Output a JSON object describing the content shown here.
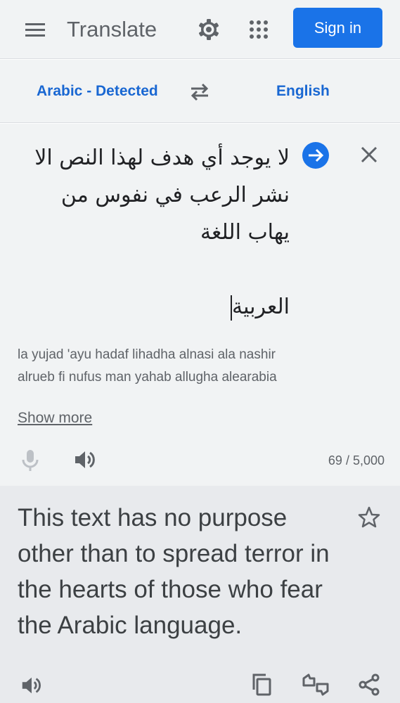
{
  "header": {
    "title": "Translate",
    "sign_in_label": "Sign in",
    "icons": [
      "menu-icon",
      "gear-icon",
      "apps-grid-icon"
    ]
  },
  "languages": {
    "source": "Arabic - Detected",
    "target": "English"
  },
  "source": {
    "text": "لا يوجد أي هدف لهذا النص الا نشر الرعب في نفوس من يهاب اللغة\n\nالعربية",
    "transliteration": "la yujad 'ayu hadaf lihadha alnasi ala nashir alrueb fi nufus man yahab allugha alearabia",
    "show_more_label": "Show more",
    "char_count": "69 / 5,000"
  },
  "result": {
    "text": "This text has no purpose other than to spread terror in the hearts of those who fear the Arabic language."
  },
  "colors": {
    "accent": "#1a73e8",
    "link": "#1967d2",
    "panel": "#f1f3f4",
    "result_panel": "#e8eaed"
  }
}
